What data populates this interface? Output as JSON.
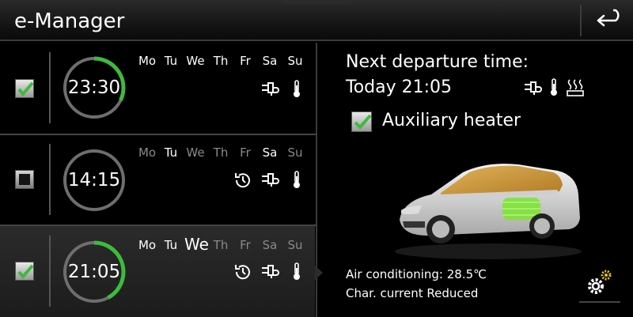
{
  "header": {
    "title": "e-Manager"
  },
  "timers": [
    {
      "checked": true,
      "time": "23:30",
      "progress": 0.32,
      "days": [
        "Mo",
        "Tu",
        "We",
        "Th",
        "Fr",
        "Sa",
        "Su"
      ],
      "icons": [
        "plug-icon",
        "thermometer-icon"
      ]
    },
    {
      "checked": false,
      "time": "14:15",
      "progress": 0,
      "days": [
        "Mo",
        "Tu",
        "We",
        "Th",
        "Fr",
        "Sa",
        "Su"
      ],
      "icons": [
        "recurring-timer-icon",
        "plug-icon",
        "thermometer-icon"
      ]
    },
    {
      "checked": true,
      "time": "21:05",
      "progress": 0.42,
      "days": [
        "Mo",
        "Tu",
        "We",
        "Th",
        "Fr",
        "Sa",
        "Su"
      ],
      "icons": [
        "recurring-timer-icon",
        "plug-icon",
        "thermometer-icon"
      ]
    }
  ],
  "departure": {
    "label": "Next departure time:",
    "time": "Today 21:05",
    "icons": [
      "plug-icon",
      "thermometer-icon",
      "heater-icon"
    ]
  },
  "aux_heater": {
    "checked": true,
    "label": "Auxiliary heater"
  },
  "status": {
    "ac": "Air conditioning: 28.5℃",
    "charge": "Char. current Reduced"
  },
  "colors": {
    "accent_green": "#3dbb3d",
    "ring_gray": "#6e6e6e"
  }
}
